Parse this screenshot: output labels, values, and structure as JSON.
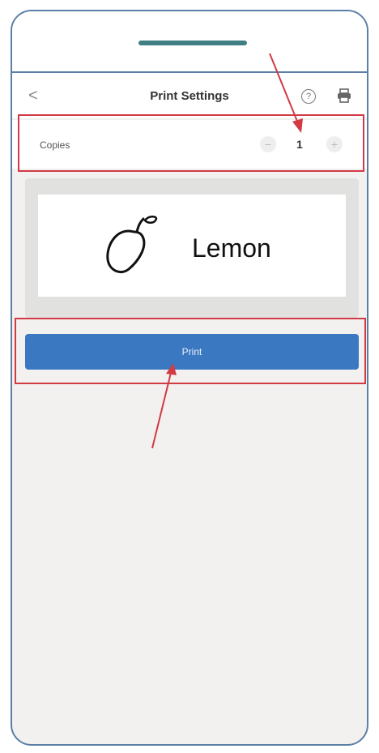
{
  "navbar": {
    "back_icon": "chevron-left-icon",
    "back_glyph": "<",
    "title": "Print Settings",
    "help_icon": "help-circle-icon",
    "help_glyph": "?",
    "printer_icon": "printer-icon"
  },
  "copies": {
    "label": "Copies",
    "value": "1",
    "minus_glyph": "−",
    "plus_glyph": "+"
  },
  "preview": {
    "label_text": "Lemon",
    "image_icon": "lemon-icon"
  },
  "print_button": {
    "label": "Print"
  },
  "colors": {
    "accent_blue": "#3b78c2",
    "annotation_red": "#d23a44",
    "frame_blue": "#5b7fa6",
    "speaker": "#3f7f83"
  }
}
